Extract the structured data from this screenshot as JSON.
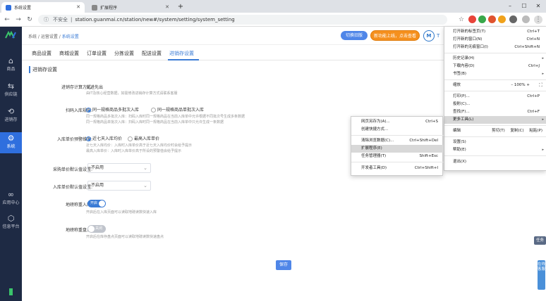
{
  "browser": {
    "tabs": [
      {
        "title": "系统设置",
        "active": true
      },
      {
        "title": "扩展程序",
        "active": false
      }
    ],
    "address": {
      "insecure_label": "不安全",
      "url": "station.guanmai.cn/station/new#/system/setting/system_setting"
    },
    "window_controls": [
      "–",
      "☐",
      "✕"
    ]
  },
  "sidebar": {
    "items": [
      {
        "label": "商品",
        "icon": "bag-icon"
      },
      {
        "label": "供应链",
        "icon": "exchange-icon"
      },
      {
        "label": "进销存",
        "icon": "stock-icon"
      },
      {
        "label": "系统",
        "icon": "gear-icon",
        "active": true
      },
      {
        "label": "应用中心",
        "icon": "apps-icon"
      },
      {
        "label": "信息平台",
        "icon": "cube-icon"
      }
    ]
  },
  "header": {
    "breadcrumb": [
      "系统",
      "运营设置",
      "系统设置"
    ],
    "switch_button": "切换旧版",
    "promo_button": "新功能上线，点击查看",
    "logo_text": "T"
  },
  "setting_tabs": [
    "商品设置",
    "商城设置",
    "订单设置",
    "分拣设置",
    "配送设置",
    "进销存设置"
  ],
  "content": {
    "section_title": "进销存设置",
    "cost_method": {
      "label": "进销存计算方式:",
      "value": "先进先出",
      "hint": "由IT及核心经营数据，如需修改进销存计算方式请联系客服"
    },
    "scan_rule": {
      "label": "扫码入库规则:",
      "options": [
        "同一规格商品多批次入库",
        "同一规格商品单批次入库"
      ],
      "hints": [
        "同一规格商品多批次入库：扫码入库时同一规格商品在当前入库单中允许根据不同批次号生成多条数据",
        "同一规格商品单批次入库：扫码入库时同一规格商品在当前入库单中只允许生成一条数据"
      ]
    },
    "price_warning": {
      "label": "入库单价预警维度:",
      "options": [
        "近七天入库均价",
        "最高入库单价"
      ],
      "hints": [
        "近七天入库均价：入库时入库单价高于近七天入库均价时会给予提示",
        "最高入库单价：入库时入库单价高于所设的预警值会给予提示"
      ]
    },
    "purchase_default": {
      "label": "采购单价默认值设置:",
      "value": "不启用"
    },
    "stockin_default": {
      "label": "入库单价默认值设置:",
      "value": "不启用"
    },
    "weigh_in": {
      "label": "地磅称重入库:",
      "toggle": "开启",
      "hint": "开启后在入库页面可以读取地磅读数快速入库"
    },
    "weigh_check": {
      "label": "地磅称重盘点:",
      "toggle": "关闭",
      "hint": "开启后在库存盘点页面可以读取地磅读数快速盘点"
    },
    "save": "保存"
  },
  "chrome_menu": {
    "items": [
      {
        "label": "打开新的标签页(T)",
        "shortcut": "Ctrl+T"
      },
      {
        "label": "打开新的窗口(N)",
        "shortcut": "Ctrl+N"
      },
      {
        "label": "打开新的无痕窗口(I)",
        "shortcut": "Ctrl+Shift+N"
      },
      {
        "label": "历史记录(H)",
        "shortcut": "▸"
      },
      {
        "label": "下载内容(D)",
        "shortcut": "Ctrl+J"
      },
      {
        "label": "书签(B)",
        "shortcut": "▸"
      },
      {
        "label": "缩放",
        "shortcut": "–   100%   +"
      },
      {
        "label": "打印(P)...",
        "shortcut": "Ctrl+P"
      },
      {
        "label": "投射(C)...",
        "shortcut": ""
      },
      {
        "label": "查找(F)...",
        "shortcut": "Ctrl+F"
      },
      {
        "label": "更多工具(L)",
        "shortcut": "▸"
      },
      {
        "label": "编辑",
        "shortcut": "剪切(T)  复制(C)  粘贴(P)"
      },
      {
        "label": "设置(S)",
        "shortcut": ""
      },
      {
        "label": "帮助(E)",
        "shortcut": "▸"
      },
      {
        "label": "退出(X)",
        "shortcut": ""
      }
    ]
  },
  "more_tools_menu": {
    "items": [
      {
        "label": "网页另存为(A)...",
        "shortcut": "Ctrl+S"
      },
      {
        "label": "创建快捷方式...",
        "shortcut": ""
      },
      {
        "label": "清除浏览数据(C)...",
        "shortcut": "Ctrl+Shift+Del"
      },
      {
        "label": "扩展程序(E)",
        "shortcut": ""
      },
      {
        "label": "任务管理器(T)",
        "shortcut": "Shift+Esc"
      },
      {
        "label": "开发者工具(D)",
        "shortcut": "Ctrl+Shift+I"
      }
    ]
  },
  "floating": {
    "task": "任务",
    "service": "在线客服"
  }
}
